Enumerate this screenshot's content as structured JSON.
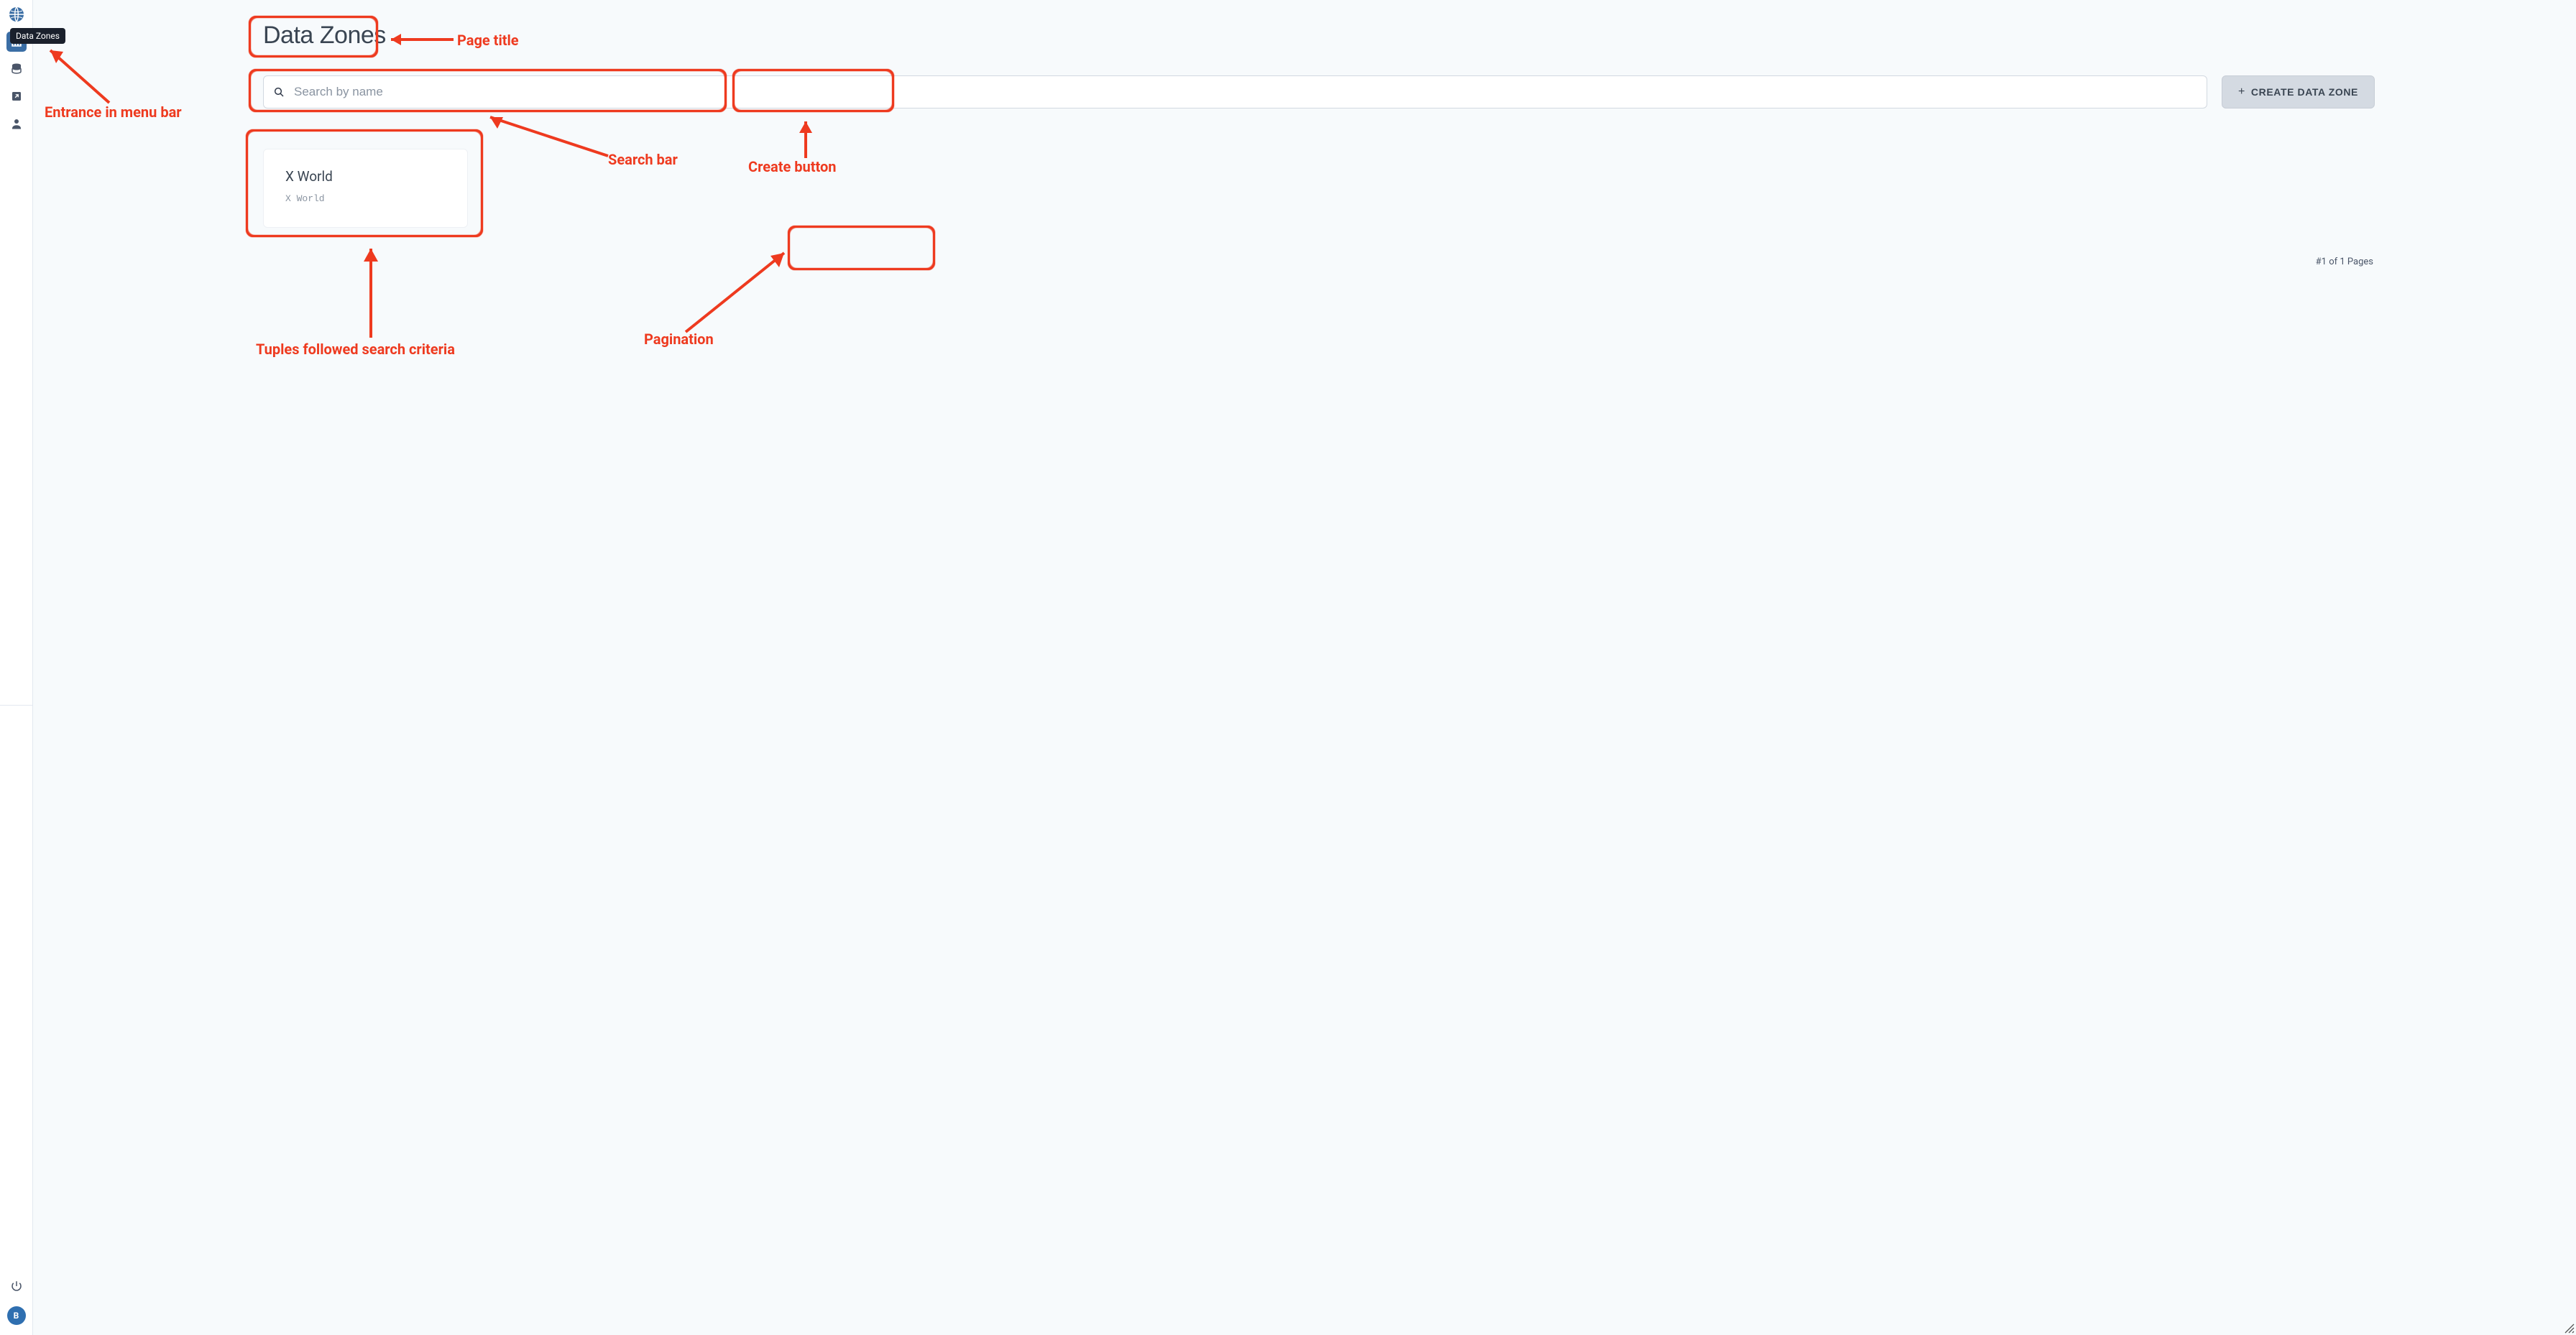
{
  "sidebar": {
    "tooltip": "Data Zones",
    "items": [
      {
        "name": "globe-icon",
        "active": false
      },
      {
        "name": "data-zones-icon",
        "active": true
      },
      {
        "name": "database-icon",
        "active": false
      },
      {
        "name": "external-icon",
        "active": false
      },
      {
        "name": "user-icon",
        "active": false
      }
    ],
    "footer": {
      "power_name": "power-icon",
      "badge_letter": "B"
    }
  },
  "page": {
    "title": "Data Zones"
  },
  "search": {
    "placeholder": "Search by name",
    "value": ""
  },
  "create_button": {
    "plus": "+",
    "label": "Create Data Zone"
  },
  "results": [
    {
      "title": "X World",
      "desc": "X World"
    }
  ],
  "pagination": {
    "text": "#1 of 1 Pages"
  },
  "annotations": {
    "page_title_label": "Page title",
    "entrance_label": "Entrance in menu bar",
    "search_label": "Search bar",
    "create_label": "Create button",
    "tuples_label": "Tuples followed search criteria",
    "pagination_label": "Pagination"
  }
}
